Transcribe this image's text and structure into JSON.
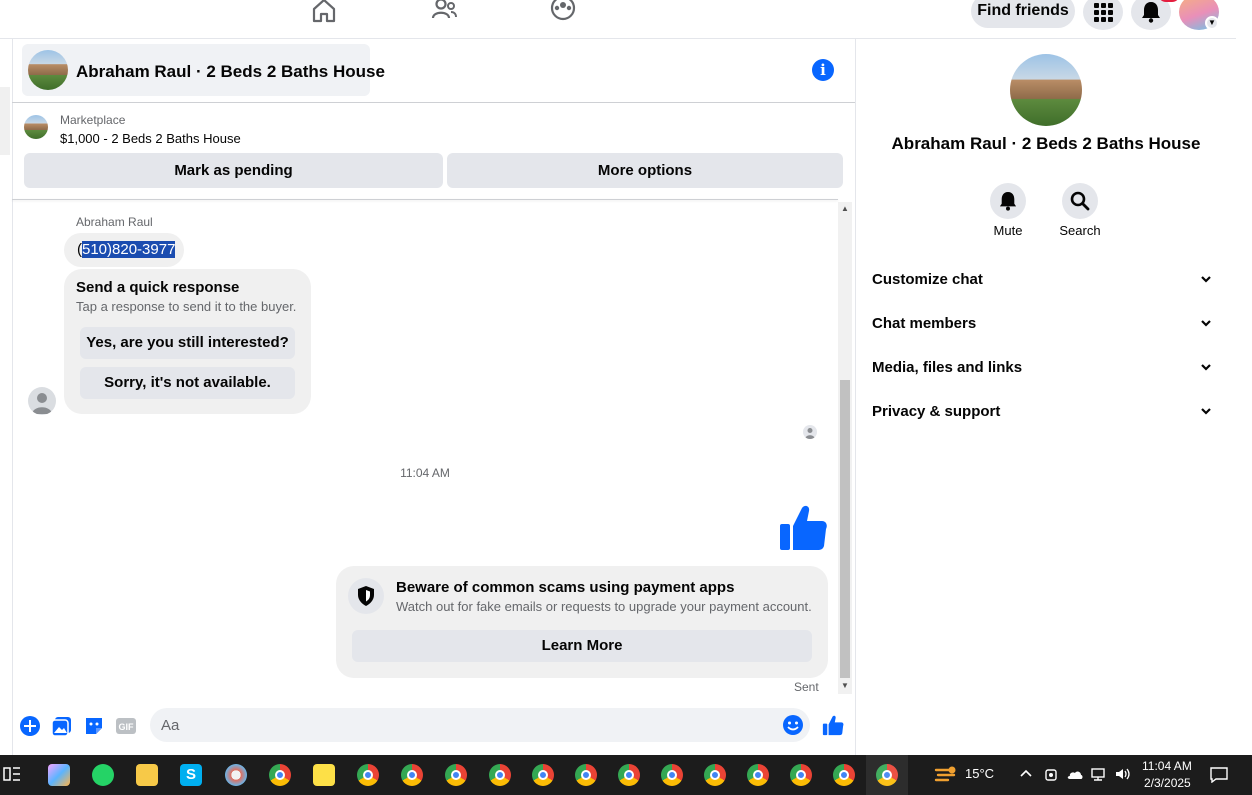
{
  "topnav": {
    "find_friends_label": "Find friends"
  },
  "chat": {
    "header_title": "Abraham Raul · 2 Beds 2 Baths House",
    "marketplace_label": "Marketplace",
    "listing_price_title": "$1,000 - 2 Beds 2 Baths House",
    "mark_pending_label": "Mark as pending",
    "more_options_label": "More options",
    "sender_name": "Abraham Raul",
    "phone_first_char": "(",
    "phone_selected": "510)820-3977",
    "quick_response_title": "Send a quick response",
    "quick_response_sub": "Tap a response to send it to the buyer.",
    "quick_responses": [
      "Yes, are you still interested?",
      "Sorry, it's not available."
    ],
    "timestamp": "11:04 AM",
    "scam_title": "Beware of common scams using payment apps",
    "scam_sub": "Watch out for fake emails or requests to upgrade your payment account.",
    "learn_more_label": "Learn More",
    "sent_status": "Sent",
    "composer_placeholder": "Aa"
  },
  "right_panel": {
    "title": "Abraham Raul · 2 Beds 2 Baths House",
    "mute_label": "Mute",
    "search_label": "Search",
    "sections": [
      "Customize chat",
      "Chat members",
      "Media, files and links",
      "Privacy & support"
    ]
  },
  "taskbar": {
    "weather": "15°C",
    "time": "11:04 AM",
    "date": "2/3/2025"
  },
  "colors": {
    "accent": "#0866ff",
    "bubble": "#f0f0f0",
    "button": "#e4e6eb",
    "taskbar": "#1c1c1c"
  }
}
